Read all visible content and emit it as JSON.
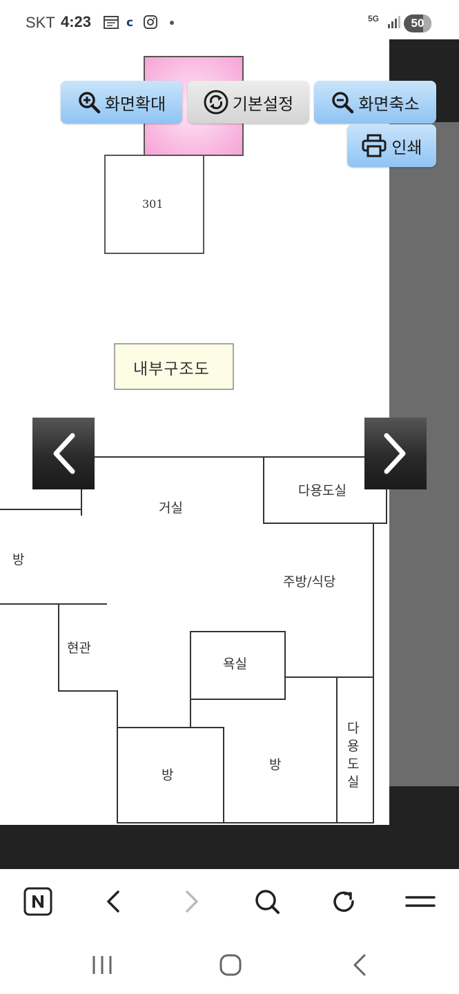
{
  "status_bar": {
    "carrier": "SKT",
    "time": "4:23",
    "battery": "50",
    "network": "5G",
    "icons": [
      "calendar-icon",
      "c-app-icon",
      "instagram-icon",
      "dot-icon",
      "signal-icon"
    ]
  },
  "viewer": {
    "toolbar": {
      "zoom_in": "화면확대",
      "reset": "기본설정",
      "zoom_out": "화면축소",
      "print": "인쇄"
    },
    "colors": {
      "button_blue": "#9ccbf5",
      "button_gray": "#dcdcdc",
      "dark_bg": "#222222",
      "strip_gray": "#6c6c6c",
      "pink_room": "#f6a3d6",
      "label_bg": "#fdfde6"
    }
  },
  "floor_plan": {
    "unit_number": "301",
    "title": "내부구조도",
    "rooms": {
      "living": "거실",
      "utility_top": "다용도실",
      "room_left": "방",
      "kitchen": "주방/식당",
      "entrance": "현관",
      "bathroom": "욕실",
      "room_bottom_left": "방",
      "room_bottom_right": "방",
      "utility_bottom": "다용도실"
    }
  },
  "browser_bar": {
    "icons": [
      "naver-icon",
      "back-icon",
      "forward-icon",
      "search-icon",
      "refresh-icon",
      "menu-icon"
    ]
  },
  "system_nav": {
    "icons": [
      "recent-apps-icon",
      "home-icon",
      "back-nav-icon"
    ]
  }
}
